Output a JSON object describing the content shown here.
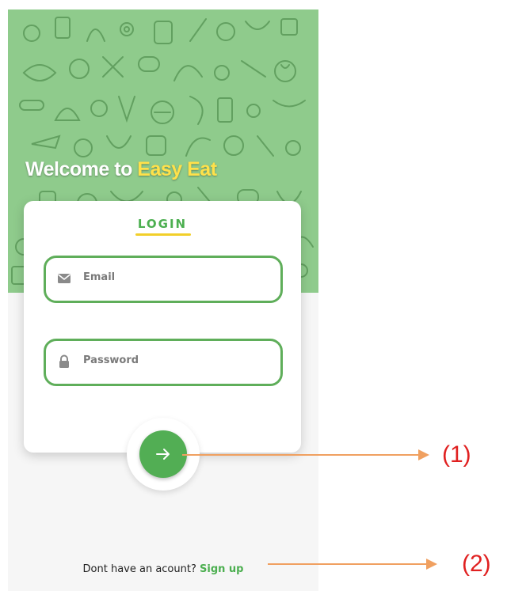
{
  "header": {
    "welcome_prefix": "Welcome to ",
    "brand_name": "Easy Eat"
  },
  "login_card": {
    "title": "LOGIN",
    "email_placeholder": "Email",
    "password_placeholder": "Password"
  },
  "submit_button": {
    "icon": "arrow-right-icon"
  },
  "footer": {
    "prompt": "Dont have an acount?",
    "signup_link": "Sign up"
  },
  "annotations": {
    "label_1": "(1)",
    "label_2": "(2)"
  },
  "colors": {
    "brand_green": "#4caf50",
    "hero_green": "#8fcb8c",
    "accent_yellow": "#f2cf2a",
    "annotation_orange": "#f0a060",
    "annotation_red": "#e02020"
  }
}
